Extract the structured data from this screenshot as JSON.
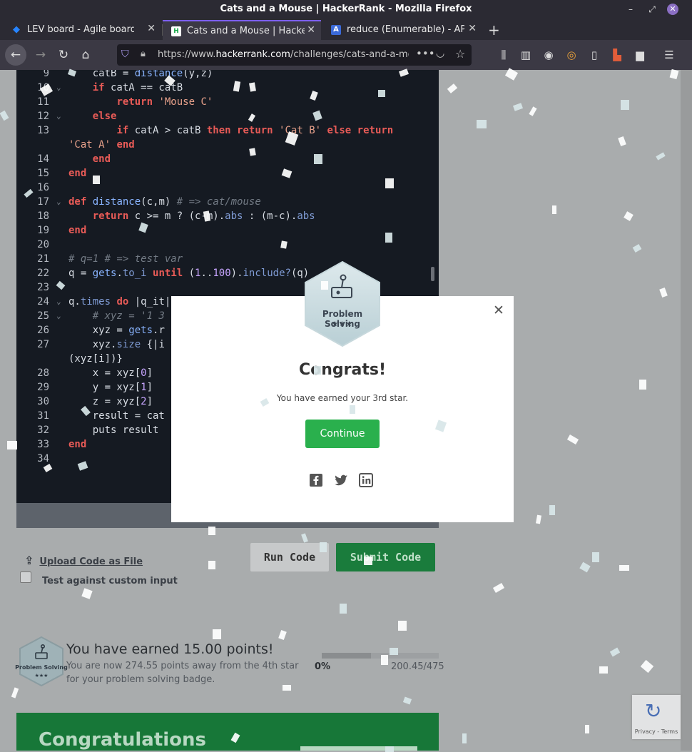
{
  "window": {
    "title": "Cats and a Mouse | HackerRank - Mozilla Firefox"
  },
  "tabs": [
    {
      "label": "LEV board - Agile board - Jira",
      "favicon": "jira-icon"
    },
    {
      "label": "Cats and a Mouse | HackerRank",
      "favicon": "hackerrank-icon"
    },
    {
      "label": "reduce (Enumerable) - APIdock",
      "favicon": "apidock-icon"
    }
  ],
  "urlbar": {
    "url_prefix": "https://www.",
    "url_domain": "hackerrank.com",
    "url_rest": "/challenges/cats-and-a-mouse"
  },
  "editor": {
    "lines": [
      {
        "n": "9",
        "fold": "",
        "html": "    catB = <span class=\"fn\">distance</span>(y,z)"
      },
      {
        "n": "10",
        "fold": "v",
        "html": "    <span class=\"kw\">if</span> catA == catB"
      },
      {
        "n": "11",
        "fold": "",
        "html": "        <span class=\"kw\">return</span> <span class=\"str\">'Mouse C'</span>"
      },
      {
        "n": "12",
        "fold": "v",
        "html": "    <span class=\"kw\">else</span>"
      },
      {
        "n": "13",
        "fold": "",
        "html": "        <span class=\"kw\">if</span> catA &gt; catB <span class=\"kw\">then</span> <span class=\"kw\">return</span> <span class=\"str\">'Cat B'</span> <span class=\"kw\">else</span> <span class=\"kw\">return</span>"
      },
      {
        "n": "",
        "fold": "",
        "html": "<span class=\"str\">'Cat A'</span> <span class=\"kw\">end</span>"
      },
      {
        "n": "14",
        "fold": "",
        "html": "    <span class=\"kw\">end</span>"
      },
      {
        "n": "15",
        "fold": "",
        "html": "<span class=\"kw\">end</span>"
      },
      {
        "n": "16",
        "fold": "",
        "html": ""
      },
      {
        "n": "17",
        "fold": "v",
        "html": "<span class=\"kw\">def</span> <span class=\"fn\">distance</span>(c,m) <span class=\"cm\"># =&gt; cat/mouse</span>"
      },
      {
        "n": "18",
        "fold": "",
        "html": "    <span class=\"kw\">return</span> c &gt;= m ? (c-m).<span class=\"kw2\">abs</span> : (m-c).<span class=\"kw2\">abs</span>"
      },
      {
        "n": "19",
        "fold": "",
        "html": "<span class=\"kw\">end</span>"
      },
      {
        "n": "20",
        "fold": "",
        "html": ""
      },
      {
        "n": "21",
        "fold": "",
        "html": "<span class=\"cm\"># q=1 # =&gt; test var</span>"
      },
      {
        "n": "22",
        "fold": "",
        "html": "q = <span class=\"fn\">gets</span>.<span class=\"kw2\">to_i</span> <span class=\"kw\">until</span> (<span class=\"num\">1</span>..<span class=\"num\">100</span>).<span class=\"kw2\">include?</span>(q)"
      },
      {
        "n": "23",
        "fold": "",
        "html": ""
      },
      {
        "n": "24",
        "fold": "v",
        "html": "q.<span class=\"kw2\">times</span> <span class=\"kw\">do</span> |q_it|"
      },
      {
        "n": "25",
        "fold": "v",
        "html": "    <span class=\"cm\"># xyz = '1 3</span>"
      },
      {
        "n": "26",
        "fold": "",
        "html": "    xyz = <span class=\"fn\">gets</span>.r"
      },
      {
        "n": "27",
        "fold": "",
        "html": "    xyz.<span class=\"kw2\">size</span> {|i"
      },
      {
        "n": "",
        "fold": "",
        "html": "(xyz[i])}"
      },
      {
        "n": "28",
        "fold": "",
        "html": "    x = xyz[<span class=\"num\">0</span>]"
      },
      {
        "n": "29",
        "fold": "",
        "html": "    y = xyz[<span class=\"num\">1</span>]"
      },
      {
        "n": "30",
        "fold": "",
        "html": "    z = xyz[<span class=\"num\">2</span>]"
      },
      {
        "n": "31",
        "fold": "",
        "html": "    result = cat"
      },
      {
        "n": "32",
        "fold": "",
        "html": "    puts result"
      },
      {
        "n": "33",
        "fold": "",
        "html": "<span class=\"kw\">end</span>"
      },
      {
        "n": "34",
        "fold": "",
        "html": ""
      }
    ]
  },
  "actions": {
    "upload_label": "Upload Code as File",
    "custom_input_label": "Test against custom input",
    "run_label": "Run Code",
    "submit_label": "Submit Code"
  },
  "earned": {
    "title": "You have earned 15.00 points!",
    "subtitle": "You are now 274.55 points away from the 4th star for your problem solving badge.",
    "percent_text": "0%",
    "points_text": "200.45/475",
    "progress_fraction": 0.42
  },
  "badge": {
    "label": "Problem Solving",
    "stars": "★★★"
  },
  "banner": {
    "text": "Congratulations"
  },
  "recaptcha": {
    "text": "Privacy - Terms"
  },
  "modal": {
    "title": "Congrats!",
    "subtitle": "You have earned your 3rd star.",
    "continue_label": "Continue",
    "share": [
      {
        "name": "facebook-icon",
        "glyph": "f"
      },
      {
        "name": "twitter-icon",
        "glyph": "t"
      },
      {
        "name": "linkedin-icon",
        "glyph": "in"
      }
    ]
  },
  "colors": {
    "submit_green": "#1a7c3c",
    "continue_green": "#2ab04d",
    "badge_fill": "#c9dde3"
  }
}
